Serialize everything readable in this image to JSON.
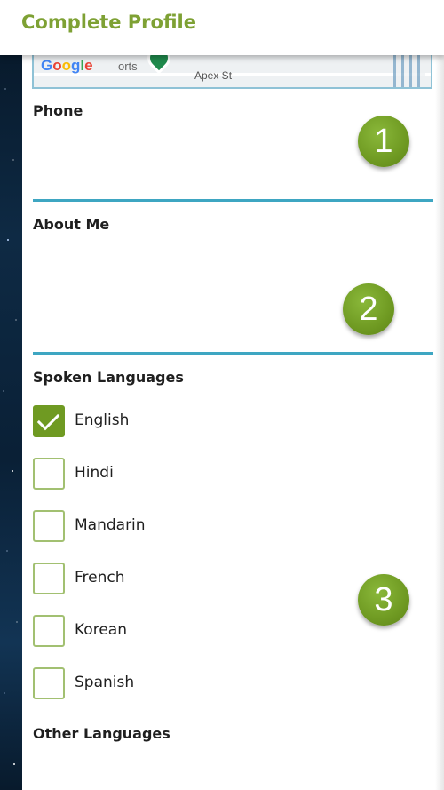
{
  "header": {
    "title": "Complete Profile"
  },
  "map": {
    "logo": "Google",
    "place_fragment": "orts",
    "street": "Apex St"
  },
  "phone": {
    "label": "Phone",
    "value": ""
  },
  "about": {
    "label": "About Me",
    "value": ""
  },
  "languages": {
    "label": "Spoken Languages",
    "items": [
      {
        "label": "English",
        "checked": true
      },
      {
        "label": "Hindi",
        "checked": false
      },
      {
        "label": "Mandarin",
        "checked": false
      },
      {
        "label": "French",
        "checked": false
      },
      {
        "label": "Korean",
        "checked": false
      },
      {
        "label": "Spanish",
        "checked": false
      }
    ]
  },
  "other_languages": {
    "label": "Other Languages"
  },
  "callouts": [
    "1",
    "2",
    "3"
  ],
  "colors": {
    "accent_green": "#7ea134",
    "checkbox_green": "#6f9a22",
    "divider_blue": "#3ea6c2"
  },
  "icons": {
    "map_pin": "map-pin-icon",
    "check": "checkmark-icon"
  }
}
